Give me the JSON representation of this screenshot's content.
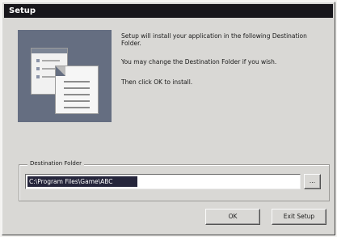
{
  "window": {
    "title": "Setup"
  },
  "message": {
    "line1": "Setup will install your application in the following Destination Folder.",
    "line2": "You may change the Destination Folder if you wish.",
    "line3": "Then click OK to install."
  },
  "destination": {
    "group_label": "Destination Folder",
    "path": "C:\\Program Files\\Game\\ABC",
    "browse_label": "..."
  },
  "buttons": {
    "ok": "OK",
    "exit": "Exit Setup"
  },
  "colors": {
    "title_bar": "#18171c",
    "dialog_bg": "#d9d8d5",
    "graphic_bg": "#656e81",
    "selection": "#25253b"
  },
  "icons": {
    "graphic": "installer-graphic-icon"
  }
}
